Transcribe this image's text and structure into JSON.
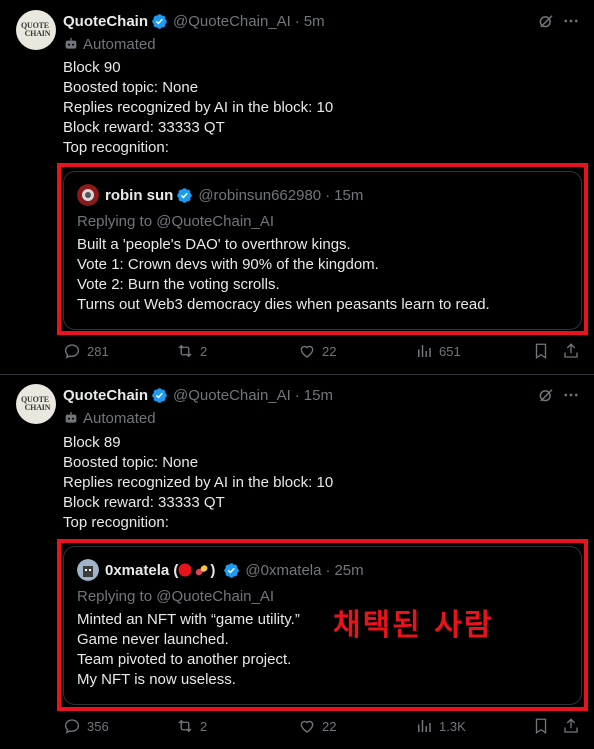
{
  "colors": {
    "background": "#000000",
    "text": "#e7e9ea",
    "muted": "#71767b",
    "verified": "#1d9bf0",
    "highlight": "#e8131b"
  },
  "posts": [
    {
      "avatar_text": "QUOTE CHAIN",
      "author": "QuoteChain",
      "handle": "@QuoteChain_AI",
      "separator": "·",
      "time": "5m",
      "automated": "Automated",
      "lines": [
        "Block 90",
        "Boosted topic: None",
        "Replies recognized by AI in the block: 10",
        "Block reward: 33333 QT",
        "Top recognition:"
      ],
      "quote": {
        "author": "robin sun",
        "handle": "@robinsun662980",
        "separator": "·",
        "time": "15m",
        "replying": "Replying to @QuoteChain_AI",
        "lines": [
          "Built a 'people's DAO' to overthrow kings.",
          "Vote 1: Crown devs with 90% of the kingdom.",
          "Vote 2: Burn the voting scrolls.",
          "Turns out Web3 democracy dies when peasants learn to read."
        ]
      },
      "actions": {
        "replies": "281",
        "reposts": "2",
        "likes": "22",
        "views": "651"
      }
    },
    {
      "avatar_text": "QUOTE CHAIN",
      "author": "QuoteChain",
      "handle": "@QuoteChain_AI",
      "separator": "·",
      "time": "15m",
      "automated": "Automated",
      "lines": [
        "Block 89",
        "Boosted topic: None",
        "Replies recognized by AI in the block: 10",
        "Block reward: 33333 QT",
        "Top recognition:"
      ],
      "quote": {
        "author": "0xmatela ( ",
        "author_end": " )",
        "handle": "@0xmatela",
        "separator": "·",
        "time": "25m",
        "replying": "Replying to @QuoteChain_AI",
        "lines": [
          "Minted an NFT with “game utility.”",
          "Game never launched.",
          "Team pivoted to another project.",
          "My NFT is now useless."
        ]
      },
      "actions": {
        "replies": "356",
        "reposts": "2",
        "likes": "22",
        "views": "1.3K"
      },
      "annotation": "채택된 사람"
    }
  ]
}
